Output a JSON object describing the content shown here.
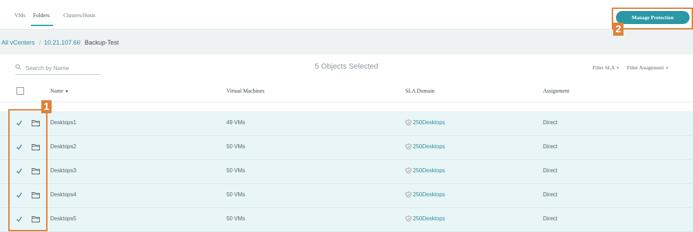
{
  "tabs": [
    {
      "label": "VMs",
      "active": false
    },
    {
      "label": "Folders",
      "active": true
    },
    {
      "label": "Clusters/Hosts",
      "active": false
    }
  ],
  "manage_button": "Manage Protection",
  "breadcrumb": [
    "All vCenters",
    "10.21.107.66",
    "Backup-Test"
  ],
  "search": {
    "placeholder": "Search by Name"
  },
  "selection_status": "5 Objects Selected",
  "filters": {
    "sla": "Filter SLA",
    "assignment": "Filter Assignment"
  },
  "columns": [
    "Name",
    "Virtual Machines",
    "SLA Domain",
    "Assignment"
  ],
  "rows": [
    {
      "name": "Desktops1",
      "vms": "49 VMs",
      "sla": "250Desktops",
      "assignment": "Direct"
    },
    {
      "name": "Desktops2",
      "vms": "50 VMs",
      "sla": "250Desktops",
      "assignment": "Direct"
    },
    {
      "name": "Desktops3",
      "vms": "50 VMs",
      "sla": "250Desktops",
      "assignment": "Direct"
    },
    {
      "name": "Desktops4",
      "vms": "50 VMs",
      "sla": "250Desktops",
      "assignment": "Direct"
    },
    {
      "name": "Desktops5",
      "vms": "50 VMs",
      "sla": "250Desktops",
      "assignment": "Direct"
    }
  ],
  "callouts": [
    "1",
    "2"
  ],
  "colors": {
    "accent": "#2a98a5",
    "callout": "#e0803a",
    "selected_row": "#e9f5f6"
  },
  "icons": [
    "search-icon",
    "checkmark-icon",
    "folder-icon",
    "shield-icon",
    "sort-caret-icon"
  ]
}
